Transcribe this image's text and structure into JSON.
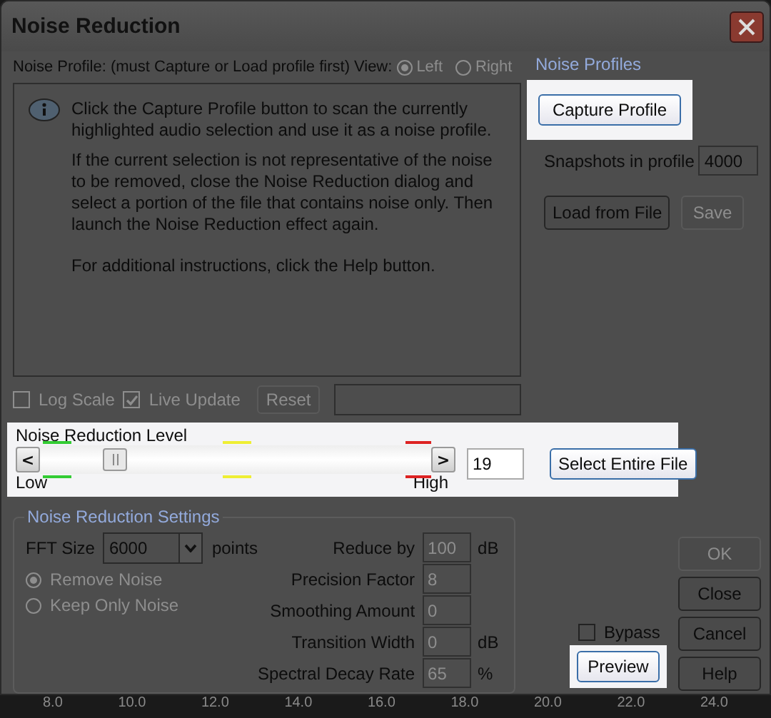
{
  "window": {
    "title": "Noise Reduction"
  },
  "profile": {
    "label": "Noise Profile: (must Capture or Load profile first)",
    "view_label": "View:",
    "views": [
      {
        "label": "Left",
        "selected": true
      },
      {
        "label": "Right",
        "selected": false
      }
    ],
    "info": [
      "Click the Capture Profile button to scan the currently highlighted audio selection and use it as a noise profile.",
      "If the current selection is not representative of the noise to be removed, close the Noise Reduction dialog and select a portion of the file that contains noise only.  Then launch the Noise Reduction effect again.",
      "For additional instructions, click the Help button."
    ],
    "options": [
      {
        "label": "Log Scale",
        "checked": false
      },
      {
        "label": "Live Update",
        "checked": true
      }
    ],
    "reset": "Reset"
  },
  "noise_profiles": {
    "title": "Noise Profiles",
    "capture": "Capture Profile",
    "snapshots_label": "Snapshots in profile",
    "snapshots": "4000",
    "load": "Load from File",
    "save": "Save"
  },
  "level": {
    "title": "Noise Reduction Level",
    "low": "Low",
    "high": "High",
    "level": 0.19,
    "value": "19",
    "select_entire": "Select Entire File",
    "prev": "<",
    "next": ">"
  },
  "settings": {
    "title": "Noise Reduction Settings",
    "fft_label": "FFT Size",
    "fft": "6000",
    "fft_unit": "points",
    "modes": [
      {
        "label": "Remove Noise",
        "selected": true
      },
      {
        "label": "Keep Only Noise",
        "selected": false
      }
    ],
    "params": [
      {
        "label": "Reduce by",
        "value": "100",
        "unit": "dB"
      },
      {
        "label": "Precision Factor",
        "value": "8"
      },
      {
        "label": "Smoothing Amount",
        "value": "0"
      },
      {
        "label": "Transition Width",
        "value": "0",
        "unit": "dB"
      },
      {
        "label": "Spectral Decay Rate",
        "value": "65",
        "unit": "%"
      }
    ]
  },
  "bypass": {
    "label": "Bypass",
    "checked": false
  },
  "preview": "Preview",
  "buttons": [
    {
      "label": "OK",
      "disabled": true
    },
    {
      "label": "Close",
      "disabled": false
    },
    {
      "label": "Cancel",
      "disabled": false
    },
    {
      "label": "Help",
      "disabled": false
    }
  ],
  "ruler": [
    "8.0",
    "10.0",
    "12.0",
    "14.0",
    "16.0",
    "18.0",
    "20.0",
    "22.0",
    "24.0"
  ]
}
